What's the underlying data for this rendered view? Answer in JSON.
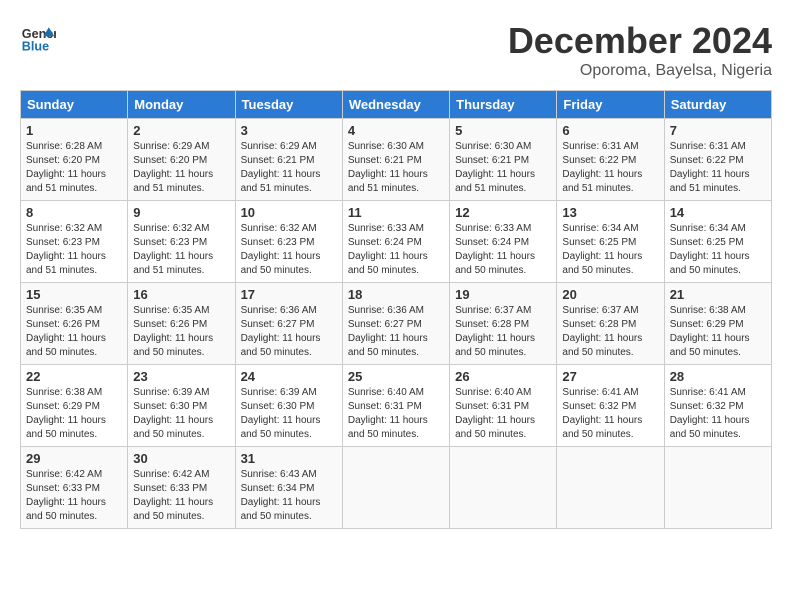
{
  "logo": {
    "line1": "General",
    "line2": "Blue"
  },
  "title": "December 2024",
  "subtitle": "Oporoma, Bayelsa, Nigeria",
  "headers": [
    "Sunday",
    "Monday",
    "Tuesday",
    "Wednesday",
    "Thursday",
    "Friday",
    "Saturday"
  ],
  "weeks": [
    [
      {
        "day": "1",
        "content": "Sunrise: 6:28 AM\nSunset: 6:20 PM\nDaylight: 11 hours\nand 51 minutes."
      },
      {
        "day": "2",
        "content": "Sunrise: 6:29 AM\nSunset: 6:20 PM\nDaylight: 11 hours\nand 51 minutes."
      },
      {
        "day": "3",
        "content": "Sunrise: 6:29 AM\nSunset: 6:21 PM\nDaylight: 11 hours\nand 51 minutes."
      },
      {
        "day": "4",
        "content": "Sunrise: 6:30 AM\nSunset: 6:21 PM\nDaylight: 11 hours\nand 51 minutes."
      },
      {
        "day": "5",
        "content": "Sunrise: 6:30 AM\nSunset: 6:21 PM\nDaylight: 11 hours\nand 51 minutes."
      },
      {
        "day": "6",
        "content": "Sunrise: 6:31 AM\nSunset: 6:22 PM\nDaylight: 11 hours\nand 51 minutes."
      },
      {
        "day": "7",
        "content": "Sunrise: 6:31 AM\nSunset: 6:22 PM\nDaylight: 11 hours\nand 51 minutes."
      }
    ],
    [
      {
        "day": "8",
        "content": "Sunrise: 6:32 AM\nSunset: 6:23 PM\nDaylight: 11 hours\nand 51 minutes."
      },
      {
        "day": "9",
        "content": "Sunrise: 6:32 AM\nSunset: 6:23 PM\nDaylight: 11 hours\nand 51 minutes."
      },
      {
        "day": "10",
        "content": "Sunrise: 6:32 AM\nSunset: 6:23 PM\nDaylight: 11 hours\nand 50 minutes."
      },
      {
        "day": "11",
        "content": "Sunrise: 6:33 AM\nSunset: 6:24 PM\nDaylight: 11 hours\nand 50 minutes."
      },
      {
        "day": "12",
        "content": "Sunrise: 6:33 AM\nSunset: 6:24 PM\nDaylight: 11 hours\nand 50 minutes."
      },
      {
        "day": "13",
        "content": "Sunrise: 6:34 AM\nSunset: 6:25 PM\nDaylight: 11 hours\nand 50 minutes."
      },
      {
        "day": "14",
        "content": "Sunrise: 6:34 AM\nSunset: 6:25 PM\nDaylight: 11 hours\nand 50 minutes."
      }
    ],
    [
      {
        "day": "15",
        "content": "Sunrise: 6:35 AM\nSunset: 6:26 PM\nDaylight: 11 hours\nand 50 minutes."
      },
      {
        "day": "16",
        "content": "Sunrise: 6:35 AM\nSunset: 6:26 PM\nDaylight: 11 hours\nand 50 minutes."
      },
      {
        "day": "17",
        "content": "Sunrise: 6:36 AM\nSunset: 6:27 PM\nDaylight: 11 hours\nand 50 minutes."
      },
      {
        "day": "18",
        "content": "Sunrise: 6:36 AM\nSunset: 6:27 PM\nDaylight: 11 hours\nand 50 minutes."
      },
      {
        "day": "19",
        "content": "Sunrise: 6:37 AM\nSunset: 6:28 PM\nDaylight: 11 hours\nand 50 minutes."
      },
      {
        "day": "20",
        "content": "Sunrise: 6:37 AM\nSunset: 6:28 PM\nDaylight: 11 hours\nand 50 minutes."
      },
      {
        "day": "21",
        "content": "Sunrise: 6:38 AM\nSunset: 6:29 PM\nDaylight: 11 hours\nand 50 minutes."
      }
    ],
    [
      {
        "day": "22",
        "content": "Sunrise: 6:38 AM\nSunset: 6:29 PM\nDaylight: 11 hours\nand 50 minutes."
      },
      {
        "day": "23",
        "content": "Sunrise: 6:39 AM\nSunset: 6:30 PM\nDaylight: 11 hours\nand 50 minutes."
      },
      {
        "day": "24",
        "content": "Sunrise: 6:39 AM\nSunset: 6:30 PM\nDaylight: 11 hours\nand 50 minutes."
      },
      {
        "day": "25",
        "content": "Sunrise: 6:40 AM\nSunset: 6:31 PM\nDaylight: 11 hours\nand 50 minutes."
      },
      {
        "day": "26",
        "content": "Sunrise: 6:40 AM\nSunset: 6:31 PM\nDaylight: 11 hours\nand 50 minutes."
      },
      {
        "day": "27",
        "content": "Sunrise: 6:41 AM\nSunset: 6:32 PM\nDaylight: 11 hours\nand 50 minutes."
      },
      {
        "day": "28",
        "content": "Sunrise: 6:41 AM\nSunset: 6:32 PM\nDaylight: 11 hours\nand 50 minutes."
      }
    ],
    [
      {
        "day": "29",
        "content": "Sunrise: 6:42 AM\nSunset: 6:33 PM\nDaylight: 11 hours\nand 50 minutes."
      },
      {
        "day": "30",
        "content": "Sunrise: 6:42 AM\nSunset: 6:33 PM\nDaylight: 11 hours\nand 50 minutes."
      },
      {
        "day": "31",
        "content": "Sunrise: 6:43 AM\nSunset: 6:34 PM\nDaylight: 11 hours\nand 50 minutes."
      },
      {
        "day": "",
        "content": ""
      },
      {
        "day": "",
        "content": ""
      },
      {
        "day": "",
        "content": ""
      },
      {
        "day": "",
        "content": ""
      }
    ]
  ]
}
